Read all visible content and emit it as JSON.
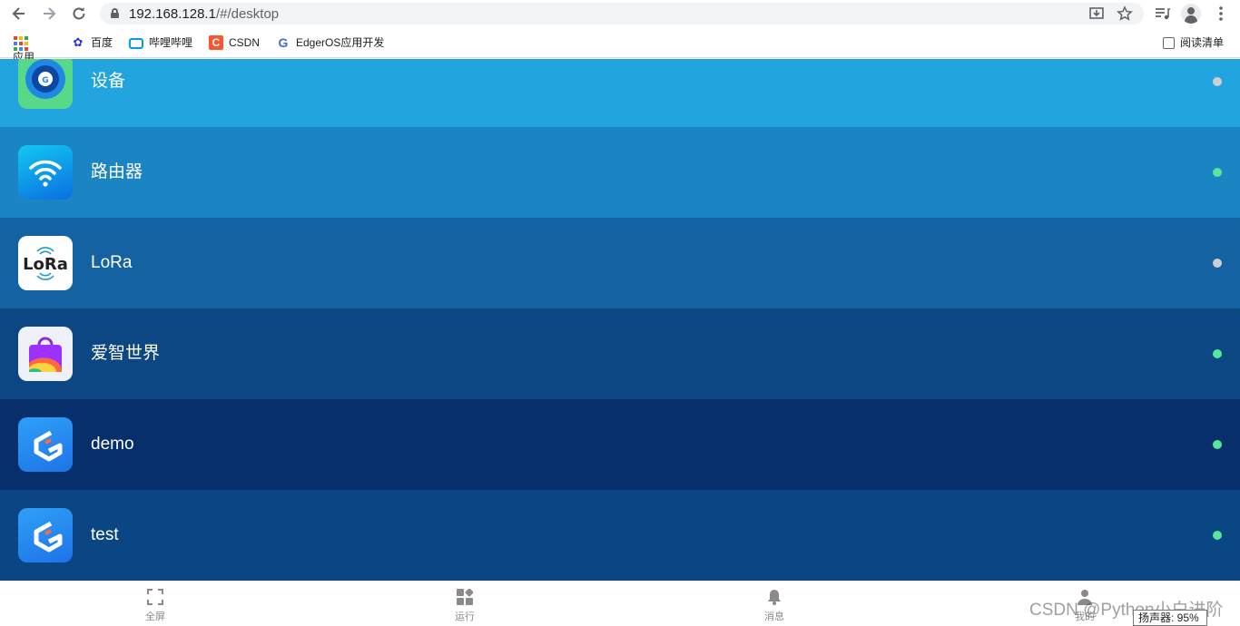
{
  "browser": {
    "url_host": "192.168.128.1",
    "url_path": "/#/desktop",
    "icons": {
      "back": "arrow-left-icon",
      "forward": "arrow-right-icon",
      "reload": "reload-icon",
      "install": "install-app-icon",
      "bookmark_star": "star-icon",
      "media": "media-controls-icon",
      "profile": "profile-icon",
      "menu": "kebab-menu-icon"
    }
  },
  "bookmarks": {
    "items": [
      {
        "label": "应用",
        "icon": "apps-grid-icon"
      },
      {
        "label": "百度",
        "icon": "baidu-paw-icon"
      },
      {
        "label": "哔哩哔哩",
        "icon": "bilibili-tv-icon"
      },
      {
        "label": "CSDN",
        "icon": "csdn-icon"
      },
      {
        "label": "EdgerOS应用开发",
        "icon": "edgeros-icon"
      }
    ],
    "reading_list": {
      "label": "阅读清单",
      "icon": "reading-list-icon"
    }
  },
  "apps": [
    {
      "label": "设备",
      "icon": "device-icon",
      "row_color": "#22a4df",
      "status": "inactive",
      "status_color": "#cfcfcf"
    },
    {
      "label": "路由器",
      "icon": "wifi-router-icon",
      "row_color": "#1b84c3",
      "status": "active",
      "status_color": "#56e89a"
    },
    {
      "label": "LoRa",
      "icon": "lora-icon",
      "row_color": "#1562a3",
      "status": "inactive",
      "status_color": "#cfcfcf"
    },
    {
      "label": "爱智世界",
      "icon": "store-bag-icon",
      "row_color": "#0c4683",
      "status": "active",
      "status_color": "#56e89a"
    },
    {
      "label": "demo",
      "icon": "edgeros-app-icon",
      "row_color": "#072f6b",
      "status": "active",
      "status_color": "#56e89a"
    },
    {
      "label": "test",
      "icon": "edgeros-app-icon",
      "row_color": "#0b4684",
      "status": "active",
      "status_color": "#56e89a"
    }
  ],
  "tabbar": {
    "tabs": [
      {
        "label": "全屏",
        "icon": "fullscreen-icon"
      },
      {
        "label": "运行",
        "icon": "running-apps-icon"
      },
      {
        "label": "消息",
        "icon": "bell-icon"
      },
      {
        "label": "我的",
        "icon": "user-icon"
      }
    ]
  },
  "overlay": {
    "watermark": "CSDN @Python小白进阶",
    "speaker_label": "扬声器: 95%"
  },
  "colors": {
    "active_dot": "#56e89a",
    "inactive_dot": "#cfcfcf"
  }
}
